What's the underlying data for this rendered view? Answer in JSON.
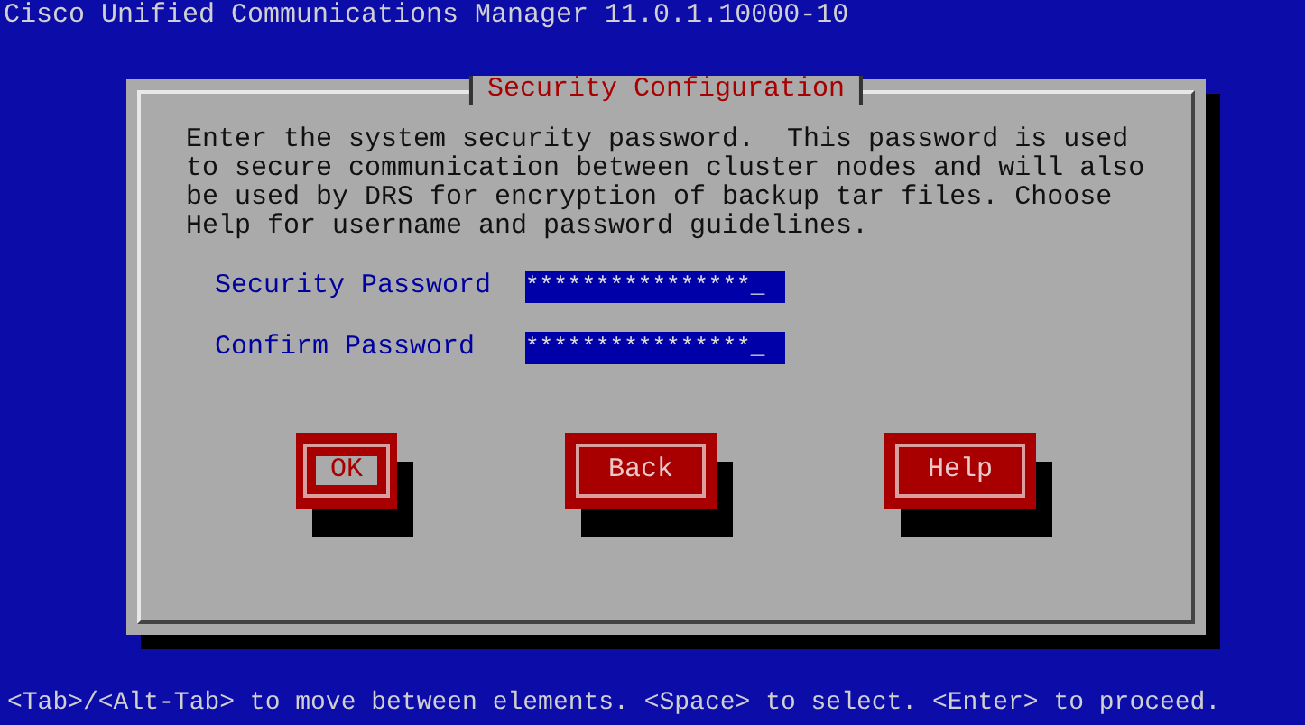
{
  "screen_title": "Cisco Unified Communications Manager 11.0.1.10000-10",
  "dialog": {
    "title": "Security Configuration",
    "message": "Enter the system security password.  This password is used to secure communication between cluster nodes and will also be used by DRS for encryption of backup tar files. Choose Help for username and password guidelines.",
    "fields": [
      {
        "label": "Security Password",
        "value": "****************_"
      },
      {
        "label": "Confirm Password",
        "value": "****************_"
      }
    ],
    "buttons": [
      {
        "label": "OK",
        "selected": true
      },
      {
        "label": "Back",
        "selected": false
      },
      {
        "label": "Help",
        "selected": false
      }
    ]
  },
  "status_bar": "<Tab>/<Alt-Tab> to move between elements. <Space> to select. <Enter> to proceed."
}
